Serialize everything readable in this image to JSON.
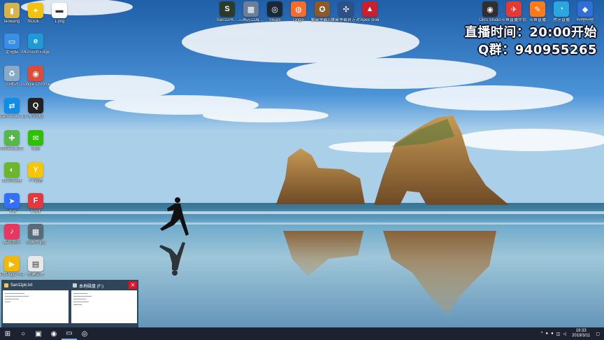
{
  "desktop": {
    "left_icons": [
      {
        "name": "laowang-icon",
        "label": "laowang",
        "glyph": "▮",
        "color": "#d8b24a"
      },
      {
        "name": "nodes-app-icon",
        "label": "NODE…",
        "glyph": "✦",
        "color": "#f4c20d"
      },
      {
        "name": "file-icon",
        "label": "1.png",
        "glyph": "▬",
        "color": "#ffffff"
      },
      {
        "name": "computer-icon",
        "label": "此电脑",
        "glyph": "▭",
        "color": "#3a8ee6"
      },
      {
        "name": "edge-icon",
        "label": "Microsoft Edge",
        "glyph": "e",
        "color": "#1e9bd7"
      },
      {
        "name": "recycle-bin-icon",
        "label": "回收站",
        "glyph": "♻",
        "color": "#8aa9c7"
      },
      {
        "name": "chrome-icon",
        "label": "Google Chrome",
        "glyph": "◉",
        "color": "#dd4b39"
      },
      {
        "name": "teamviewer-icon",
        "label": "TeamViewer 13",
        "glyph": "⇄",
        "color": "#0e8ee9"
      },
      {
        "name": "qq-icon",
        "label": "腾讯QQ",
        "glyph": "Q",
        "color": "#222222"
      },
      {
        "name": "360-security-icon",
        "label": "360安全卫士",
        "glyph": "✚",
        "color": "#54b948"
      },
      {
        "name": "wechat-icon",
        "label": "微信",
        "glyph": "✉",
        "color": "#2dc100"
      },
      {
        "name": "360-browser-icon",
        "label": "360浏览器",
        "glyph": "◐",
        "color": "#6ab72b"
      },
      {
        "name": "yy-icon",
        "label": "YY语音",
        "glyph": "Y",
        "color": "#f7c600"
      },
      {
        "name": "feishu-icon",
        "label": "飞书",
        "glyph": "➤",
        "color": "#3370ff"
      },
      {
        "name": "foxit-icon",
        "label": "Foxit",
        "glyph": "F",
        "color": "#e03a3e"
      },
      {
        "name": "music-app-icon",
        "label": "酷我音乐",
        "glyph": "♪",
        "color": "#e8375f"
      },
      {
        "name": "image-file-icon",
        "label": "三国杀.jpg",
        "glyph": "▦",
        "color": "#596a7a"
      },
      {
        "name": "potplayer-icon",
        "label": "PotPlayer 64",
        "glyph": "▶",
        "color": "#f5b800"
      },
      {
        "name": "doc-file-icon",
        "label": "新建文本",
        "glyph": "▤",
        "color": "#e8e8e8"
      }
    ],
    "top_icons": [
      {
        "name": "san11pk-icon",
        "label": "San11PK…",
        "glyph": "S",
        "color": "#2c3a2a"
      },
      {
        "name": "san11-game-icon",
        "label": "三国志11威…",
        "glyph": "▩",
        "color": "#6b7f9b"
      },
      {
        "name": "steam-icon",
        "label": "Steam",
        "glyph": "◎",
        "color": "#1b2838"
      },
      {
        "name": "origin-icon",
        "label": "Origin",
        "glyph": "◍",
        "color": "#f56c2d"
      },
      {
        "name": "warcraft-icon",
        "label": "魔兽争霸3…",
        "glyph": "✪",
        "color": "#8a5a2b"
      },
      {
        "name": "warcraft-platform-icon",
        "label": "魔兽争霸官方对战平台",
        "glyph": "✣",
        "color": "#2d4f8a"
      },
      {
        "name": "apex-icon",
        "label": "Apex 英雄",
        "glyph": "▲",
        "color": "#c8202f"
      }
    ],
    "top_right_icons": [
      {
        "name": "obs-icon",
        "label": "OBS Studio",
        "glyph": "◉",
        "color": "#302e31"
      },
      {
        "name": "live-assistant-icon",
        "label": "斗鱼直播伴侣",
        "glyph": "✈",
        "color": "#e53935"
      },
      {
        "name": "douyu-icon",
        "label": "斗鱼直播",
        "glyph": "✎",
        "color": "#ff7a1a"
      },
      {
        "name": "huya-icon",
        "label": "虎牙直播",
        "glyph": "◔",
        "color": "#2aa7e0"
      },
      {
        "name": "bili-icon",
        "label": "哔哩哔哩",
        "glyph": "◆",
        "color": "#2f6fd6"
      }
    ]
  },
  "overlay": {
    "live_time": "直播时间：20:00开始",
    "qq_group": "Q群：940955265"
  },
  "taskbar_previews": [
    {
      "title": "San11pk.txt"
    },
    {
      "title": "本地磁盘 (F:)"
    }
  ],
  "taskbar": {
    "start_glyph": "⊞",
    "search_glyph": "○",
    "apps": [
      {
        "name": "taskbar-explorer-app",
        "glyph": "▣"
      },
      {
        "name": "taskbar-chrome-app",
        "glyph": "◉"
      },
      {
        "name": "taskbar-folder-app",
        "glyph": "▭"
      },
      {
        "name": "taskbar-steam-app",
        "glyph": "◎"
      }
    ],
    "tray_chevron": "^",
    "time": "19:33",
    "date": "2019/3/11",
    "notification_glyph": "▢"
  }
}
